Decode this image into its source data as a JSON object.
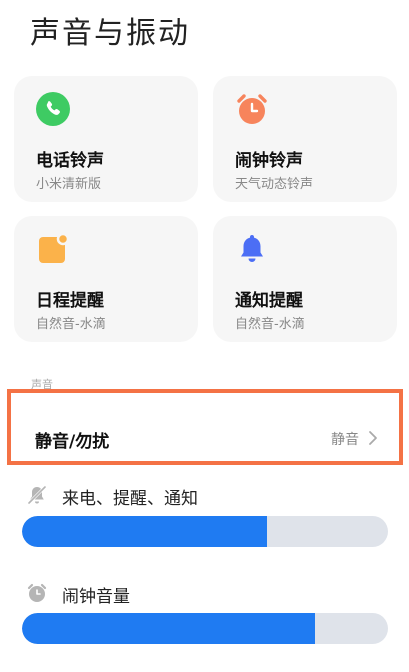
{
  "page_title": "声音与振动",
  "cards": [
    {
      "name": "电话铃声",
      "sub": "小米清新版",
      "icon": "phone-icon",
      "color": "#3ecb63"
    },
    {
      "name": "闹钟铃声",
      "sub": "天气动态铃声",
      "icon": "alarm-clock-icon",
      "color": "#f7845c"
    },
    {
      "name": "日程提醒",
      "sub": "自然音-水滴",
      "icon": "calendar-icon",
      "color": "#fbb24a"
    },
    {
      "name": "通知提醒",
      "sub": "自然音-水滴",
      "icon": "bell-icon",
      "color": "#4c6ef5"
    }
  ],
  "section_label": "声音",
  "dnd": {
    "label": "静音/勿扰",
    "value": "静音"
  },
  "volumes": [
    {
      "label": "来电、提醒、通知",
      "icon": "bell-muted-icon",
      "level": 0.67
    },
    {
      "label": "闹钟音量",
      "icon": "alarm-icon",
      "level": 0.8
    }
  ],
  "colors": {
    "accent": "#1f7bf2",
    "highlight": "#f47245"
  }
}
